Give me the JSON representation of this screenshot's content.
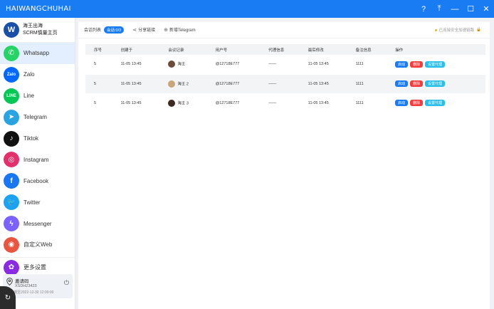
{
  "app": {
    "title": "HAIWANGCHUHAI"
  },
  "window_controls": {
    "help": "?",
    "pin": "⤒",
    "minimize": "—",
    "maximize": "☐",
    "close": "✕"
  },
  "brand": {
    "logo": "W",
    "name": "海王出海",
    "subtitle": "SCRM慎量主页"
  },
  "sidebar": {
    "items": [
      {
        "label": "Whatsapp",
        "icon": "whatsapp-icon",
        "glyph": "✆",
        "color": "#25d366"
      },
      {
        "label": "Zalo",
        "icon": "zalo-icon",
        "glyph": "Zalo",
        "color": "#0068ff"
      },
      {
        "label": "Line",
        "icon": "line-icon",
        "glyph": "LINE",
        "color": "#06c755"
      },
      {
        "label": "Telegram",
        "icon": "telegram-icon",
        "glyph": "➤",
        "color": "#2aa3e1"
      },
      {
        "label": "Tiktok",
        "icon": "tiktok-icon",
        "glyph": "♪",
        "color": "#111111"
      },
      {
        "label": "Instagram",
        "icon": "instagram-icon",
        "glyph": "◎",
        "color": "#e1306c"
      },
      {
        "label": "Facebook",
        "icon": "facebook-icon",
        "glyph": "f",
        "color": "#1877f2"
      },
      {
        "label": "Twitter",
        "icon": "twitter-icon",
        "glyph": "🐦",
        "color": "#1da1f2"
      },
      {
        "label": "Messenger",
        "icon": "messenger-icon",
        "glyph": "ϟ",
        "color": "#7b61ff"
      },
      {
        "label": "自定义Web",
        "icon": "web-icon",
        "glyph": "◉",
        "color": "#e8563f"
      }
    ],
    "more": {
      "label": "更多设置",
      "icon": "settings-icon",
      "glyph": "✿",
      "color": "#8a2be2"
    }
  },
  "invite": {
    "label": "邀请码",
    "code": "XSDH23423",
    "expiry": "有效期至2022-12-30 12:00:00"
  },
  "toolbar": {
    "session_list": "会话列表",
    "session_badge": "会话:0/3",
    "share": "分享链接",
    "new_session": "新增Telegram",
    "status": "已连接安全加速链路"
  },
  "table": {
    "headers": [
      "序号",
      "创建于",
      "会议记录",
      "用户号",
      "代理信息",
      "最后修改",
      "备注信息",
      "操作"
    ],
    "rows": [
      {
        "no": "5",
        "created": "11-05 13:45",
        "name": "海王",
        "avatar_color": "#6b4b3a",
        "user": "@12718E777",
        "proxy": "——",
        "modified": "11-05 13:45",
        "note": "1111"
      },
      {
        "no": "5",
        "created": "11-05 13:45",
        "name": "海王 2",
        "avatar_color": "#c9a57a",
        "user": "@12718E777",
        "proxy": "——",
        "modified": "11-05 13:45",
        "note": "1111"
      },
      {
        "no": "5",
        "created": "11-05 13:45",
        "name": "海王 3",
        "avatar_color": "#3a2a22",
        "user": "@12718E777",
        "proxy": "——",
        "modified": "11-05 13:45",
        "note": "1111"
      }
    ],
    "actions": {
      "start": "启动",
      "delete": "删除",
      "proxy": "设置代理"
    }
  }
}
